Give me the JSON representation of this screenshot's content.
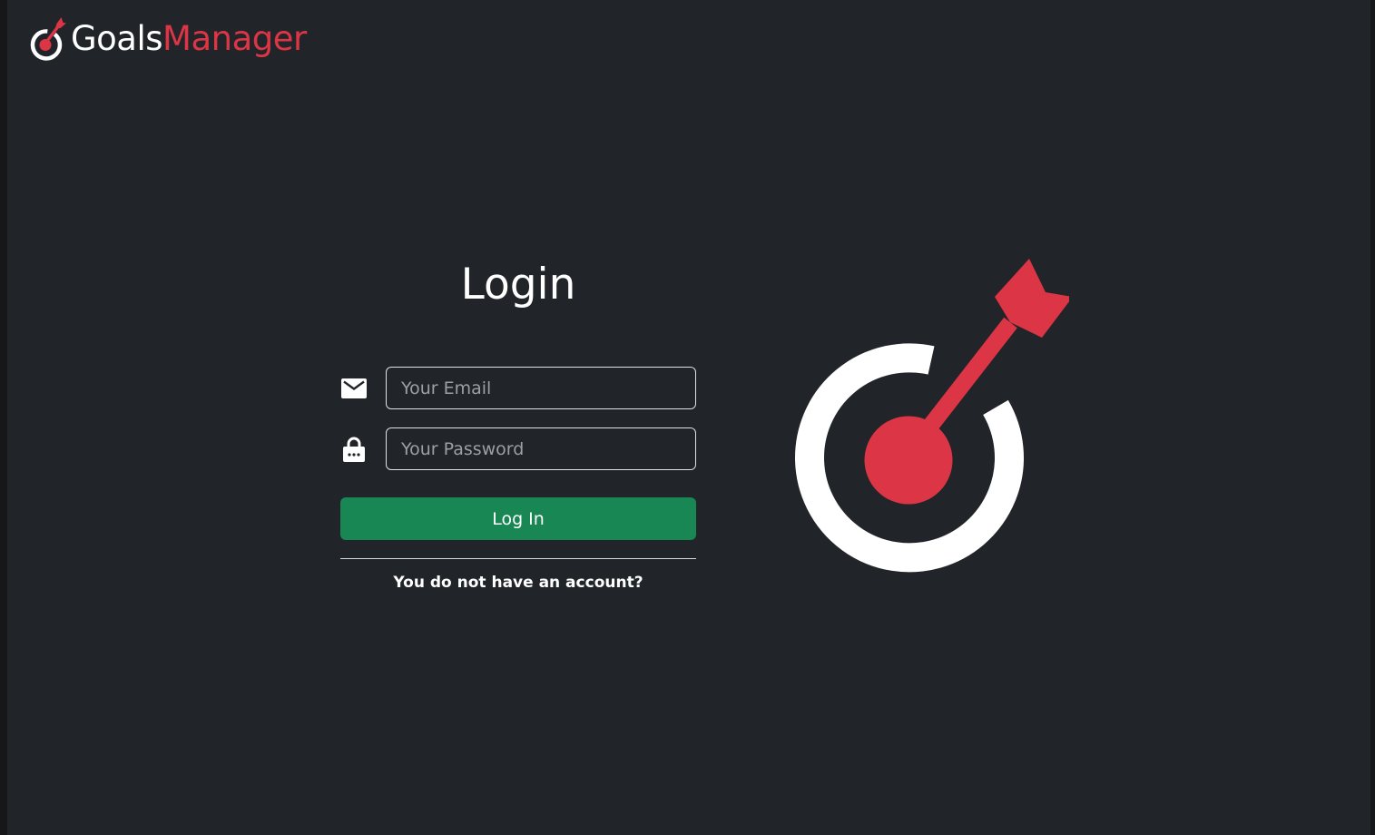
{
  "brand": {
    "name_part1": "Goals",
    "name_part2": "Manager",
    "logo_icon": "target-arrow-icon"
  },
  "colors": {
    "background": "#212429",
    "accent_red": "#dc3545",
    "button_green": "#198754",
    "text": "#ffffff"
  },
  "login": {
    "title": "Login",
    "email": {
      "icon": "envelope-icon",
      "placeholder": "Your Email",
      "value": ""
    },
    "password": {
      "icon": "lock-icon",
      "placeholder": "Your Password",
      "value": ""
    },
    "submit_label": "Log In",
    "signup_link": "You do not have an account?"
  },
  "hero": {
    "icon": "target-arrow-icon"
  }
}
